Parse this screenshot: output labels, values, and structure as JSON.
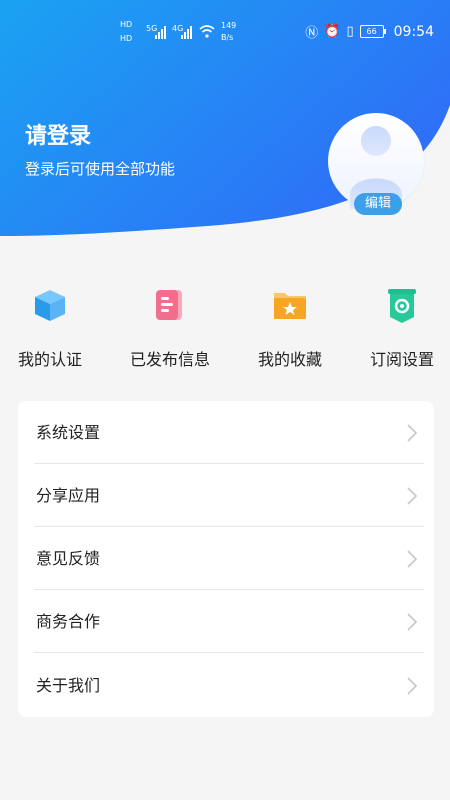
{
  "status_bar": {
    "network_1": "HD",
    "network_2": "HD",
    "signal_1": "5G",
    "signal_2": "4G",
    "speed_value": "149",
    "speed_unit": "B/s",
    "battery": "66",
    "time": "09:54"
  },
  "header": {
    "title": "请登录",
    "subtitle": "登录后可使用全部功能",
    "edit_label": "编辑"
  },
  "shortcuts": [
    {
      "label": "我的认证",
      "icon": "cube-icon"
    },
    {
      "label": "已发布信息",
      "icon": "document-icon"
    },
    {
      "label": "我的收藏",
      "icon": "folder-star-icon"
    },
    {
      "label": "订阅设置",
      "icon": "subscription-gear-icon"
    }
  ],
  "menu": {
    "items": [
      {
        "label": "系统设置"
      },
      {
        "label": "分享应用"
      },
      {
        "label": "意见反馈"
      },
      {
        "label": "商务合作"
      },
      {
        "label": "关于我们"
      }
    ]
  },
  "colors": {
    "header_gradient_start": "#1a9cf0",
    "header_gradient_end": "#2f6ef7",
    "edit_button": "#3d9fe8",
    "cube": "#2a9be8",
    "document": "#f06f8c",
    "folder": "#f6a623",
    "subscription": "#1fbf8f"
  }
}
